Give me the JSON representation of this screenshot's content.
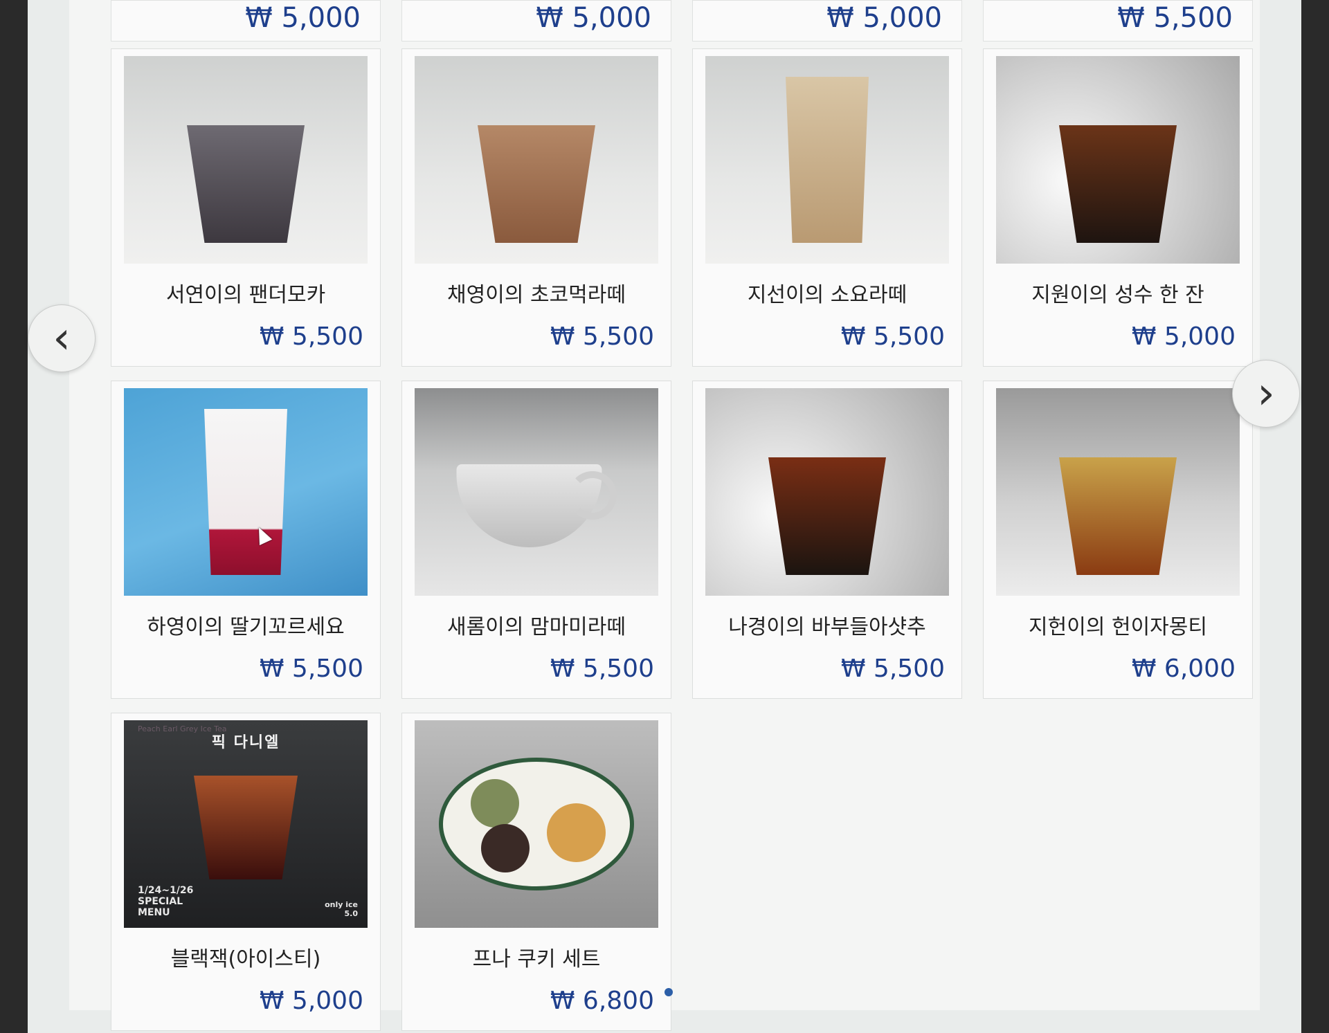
{
  "top_row": {
    "prices": [
      "₩ 5,000",
      "₩ 5,000",
      "₩ 5,000",
      "₩ 5,500"
    ]
  },
  "menu": {
    "items": [
      {
        "name": "서연이의 팬더모카",
        "price": "₩ 5,500"
      },
      {
        "name": "채영이의 초코먹라떼",
        "price": "₩ 5,500"
      },
      {
        "name": "지선이의 소요라떼",
        "price": "₩ 5,500"
      },
      {
        "name": "지원이의 성수 한 잔",
        "price": "₩ 5,000"
      },
      {
        "name": "하영이의 딸기꼬르세요",
        "price": "₩ 5,500"
      },
      {
        "name": "새롬이의 맘마미라떼",
        "price": "₩ 5,500"
      },
      {
        "name": "나경이의 바부들아샷추",
        "price": "₩ 5,500"
      },
      {
        "name": "지헌이의 헌이자몽티",
        "price": "₩ 6,000"
      },
      {
        "name": "블랙잭(아이스티)",
        "price": "₩ 5,000"
      },
      {
        "name": "프나 쿠키 세트",
        "price": "₩ 6,800"
      }
    ]
  },
  "poster": {
    "subtitle": "Peach Earl Grey Ice Tea",
    "title": "픽 다니엘",
    "footer": "1/24~1/26\nSPECIAL\nMENU",
    "note": "only ice\n5.0"
  },
  "nav": {
    "prev": "‹",
    "next": "›"
  }
}
